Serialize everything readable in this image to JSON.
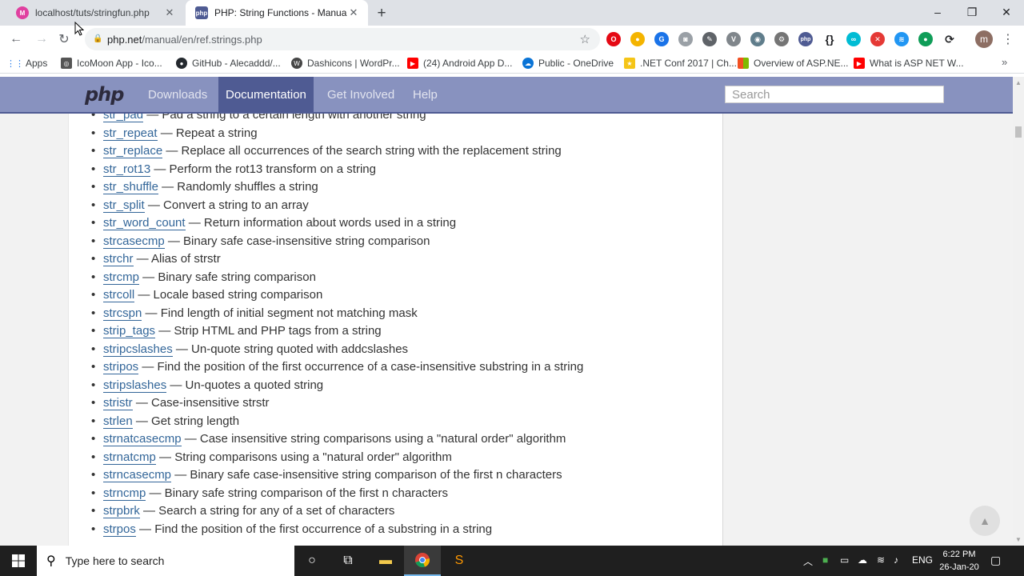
{
  "browser": {
    "tabs": [
      {
        "title": "localhost/tuts/stringfun.php",
        "favicon": "localhost-favicon",
        "active": false
      },
      {
        "title": "PHP: String Functions - Manual",
        "favicon": "php-favicon",
        "active": true
      }
    ],
    "address": {
      "host": "php.net",
      "path": "/manual/en/ref.strings.php"
    },
    "bookmarks": [
      {
        "label": "Apps",
        "icon": "apps-grid-icon"
      },
      {
        "label": "IcoMoon App - Ico...",
        "icon": "icomoon-icon"
      },
      {
        "label": "GitHub - Alecaddd/...",
        "icon": "github-icon"
      },
      {
        "label": "Dashicons | WordPr...",
        "icon": "wordpress-icon"
      },
      {
        "label": "(24) Android App D...",
        "icon": "youtube-icon"
      },
      {
        "label": "Public - OneDrive",
        "icon": "onedrive-icon"
      },
      {
        "label": ".NET Conf 2017 | Ch...",
        "icon": "dotnet-icon"
      },
      {
        "label": "Overview of ASP.NE...",
        "icon": "microsoft-icon"
      },
      {
        "label": "What is ASP NET W...",
        "icon": "youtube-icon"
      }
    ],
    "profile_initial": "m"
  },
  "php": {
    "logo": "php",
    "nav": [
      "Downloads",
      "Documentation",
      "Get Involved",
      "Help"
    ],
    "active_nav": "Documentation",
    "search_placeholder": "Search",
    "functions": [
      {
        "name": "str_pad",
        "desc": "— Pad a string to a certain length with another string"
      },
      {
        "name": "str_repeat",
        "desc": "— Repeat a string"
      },
      {
        "name": "str_replace",
        "desc": "— Replace all occurrences of the search string with the replacement string"
      },
      {
        "name": "str_rot13",
        "desc": "— Perform the rot13 transform on a string"
      },
      {
        "name": "str_shuffle",
        "desc": "— Randomly shuffles a string"
      },
      {
        "name": "str_split",
        "desc": "— Convert a string to an array"
      },
      {
        "name": "str_word_count",
        "desc": "— Return information about words used in a string"
      },
      {
        "name": "strcasecmp",
        "desc": "— Binary safe case-insensitive string comparison"
      },
      {
        "name": "strchr",
        "desc": "— Alias of strstr"
      },
      {
        "name": "strcmp",
        "desc": "— Binary safe string comparison"
      },
      {
        "name": "strcoll",
        "desc": "— Locale based string comparison"
      },
      {
        "name": "strcspn",
        "desc": "— Find length of initial segment not matching mask"
      },
      {
        "name": "strip_tags",
        "desc": "— Strip HTML and PHP tags from a string"
      },
      {
        "name": "stripcslashes",
        "desc": "— Un-quote string quoted with addcslashes"
      },
      {
        "name": "stripos",
        "desc": "— Find the position of the first occurrence of a case-insensitive substring in a string"
      },
      {
        "name": "stripslashes",
        "desc": "— Un-quotes a quoted string"
      },
      {
        "name": "stristr",
        "desc": "— Case-insensitive strstr"
      },
      {
        "name": "strlen",
        "desc": "— Get string length"
      },
      {
        "name": "strnatcasecmp",
        "desc": "— Case insensitive string comparisons using a \"natural order\" algorithm"
      },
      {
        "name": "strnatcmp",
        "desc": "— String comparisons using a \"natural order\" algorithm"
      },
      {
        "name": "strncasecmp",
        "desc": "— Binary safe case-insensitive string comparison of the first n characters"
      },
      {
        "name": "strncmp",
        "desc": "— Binary safe string comparison of the first n characters"
      },
      {
        "name": "strpbrk",
        "desc": "— Search a string for any of a set of characters"
      },
      {
        "name": "strpos",
        "desc": "— Find the position of the first occurrence of a substring in a string"
      }
    ]
  },
  "taskbar": {
    "search_placeholder": "Type here to search",
    "language": "ENG",
    "time": "6:22 PM",
    "date": "26-Jan-20"
  },
  "colors": {
    "php_nav": "#8892bf",
    "php_nav_active": "#4f5b93",
    "link": "#336699",
    "taskbar": "#1f1f1f"
  }
}
